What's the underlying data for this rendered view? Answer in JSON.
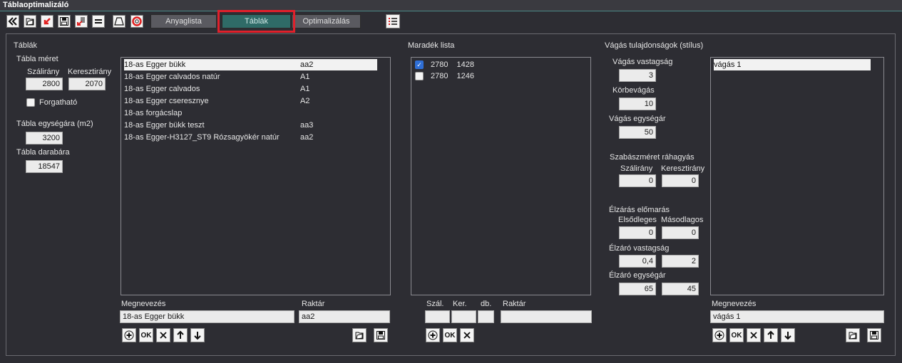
{
  "app": {
    "title": "Táblaoptimalizáló"
  },
  "tabs": [
    {
      "label": "Anyaglista"
    },
    {
      "label": "Táblák"
    },
    {
      "label": "Optimalizálás"
    }
  ],
  "tables_section": {
    "title": "Táblák",
    "size_label": "Tábla méret",
    "length_dir_label": "Szálirány",
    "cross_dir_label": "Keresztirány",
    "length_value": "2800",
    "cross_value": "2070",
    "rotatable_label": "Forgatható",
    "unit_price_label": "Tábla egységára (m2)",
    "unit_price_value": "3200",
    "piece_price_label": "Tábla darabára",
    "piece_price_value": "18547",
    "list": [
      {
        "name": "18-as Egger bükk",
        "code": "aa2"
      },
      {
        "name": "18-as Egger calvados natúr",
        "code": "A1"
      },
      {
        "name": "18-as Egger calvados",
        "code": "A1"
      },
      {
        "name": "18-as Egger cseresznye",
        "code": "A2"
      },
      {
        "name": "18-as forgácslap",
        "code": ""
      },
      {
        "name": "18-as Egger bükk teszt",
        "code": "aa3"
      },
      {
        "name": "18-as Egger-H3127_ST9 Rózsagyökér natúr",
        "code": "aa2"
      }
    ],
    "name_label": "Megnevezés",
    "warehouse_label": "Raktár",
    "name_value": "18-as Egger bükk",
    "warehouse_value": "aa2",
    "ok_label": "OK"
  },
  "remnant_section": {
    "title": "Maradék  lista",
    "items": [
      {
        "length": "2780",
        "width": "1428",
        "checked": true
      },
      {
        "length": "2780",
        "width": "1246",
        "checked": false
      }
    ],
    "len_label": "Szál.",
    "cross_label": "Ker.",
    "qty_label": "db.",
    "warehouse_label": "Raktár",
    "ok_label": "OK"
  },
  "cut_section": {
    "title": "Vágás tulajdonságok (stílus)",
    "thickness_label": "Vágás vastagság",
    "thickness_value": "3",
    "trim_label": "Körbevágás",
    "trim_value": "10",
    "unit_price_label": "Vágás egységár",
    "unit_price_value": "50",
    "allowance_label": "Szabászméret ráhagyás",
    "allowance_len_label": "Szálirány",
    "allowance_cross_label": "Keresztirány",
    "allowance_len_value": "0",
    "allowance_cross_value": "0",
    "edge_pre_label": "Élzárás előmarás",
    "primary_label": "Elsődleges",
    "secondary_label": "Másodlagos",
    "primary_value": "0",
    "secondary_value": "0",
    "edge_thick_label": "Élzáró vastagság",
    "edge_thick_1": "0,4",
    "edge_thick_2": "2",
    "edge_price_label": "Élzáró egységár",
    "edge_price_1": "65",
    "edge_price_2": "45",
    "styles": [
      {
        "name": "vágás 1"
      }
    ],
    "name_label": "Megnevezés",
    "name_value": "vágás 1",
    "ok_label": "OK"
  },
  "colors": {
    "accent": "#2f6b67",
    "highlight": "#e0202b",
    "background": "#2d2d33"
  }
}
